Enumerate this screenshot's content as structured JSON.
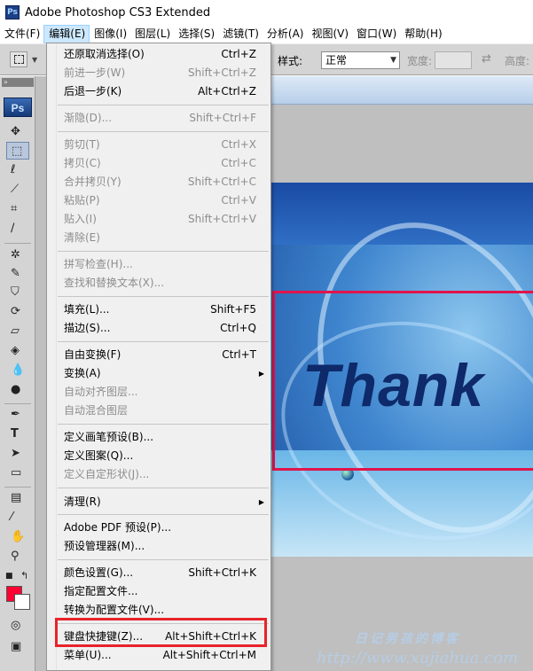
{
  "window": {
    "title": "Adobe Photoshop CS3 Extended",
    "app_icon": "Ps"
  },
  "menubar": [
    {
      "label": "文件(F)"
    },
    {
      "label": "编辑(E)"
    },
    {
      "label": "图像(I)"
    },
    {
      "label": "图层(L)"
    },
    {
      "label": "选择(S)"
    },
    {
      "label": "滤镜(T)"
    },
    {
      "label": "分析(A)"
    },
    {
      "label": "视图(V)"
    },
    {
      "label": "窗口(W)"
    },
    {
      "label": "帮助(H)"
    }
  ],
  "options_bar": {
    "style_label": "样式:",
    "style_value": "正常",
    "width_label": "宽度:",
    "height_label": "高度:"
  },
  "toolbox": {
    "logo": "Ps",
    "foreground_color": "#ff0033",
    "background_color": "#ffffff"
  },
  "edit_menu": {
    "items": [
      {
        "label": "还原取消选择(O)",
        "shortcut": "Ctrl+Z",
        "disabled": false
      },
      {
        "label": "前进一步(W)",
        "shortcut": "Shift+Ctrl+Z",
        "disabled": true
      },
      {
        "label": "后退一步(K)",
        "shortcut": "Alt+Ctrl+Z",
        "disabled": false
      },
      {
        "label": "渐隐(D)...",
        "shortcut": "Shift+Ctrl+F",
        "disabled": true
      },
      {
        "label": "剪切(T)",
        "shortcut": "Ctrl+X",
        "disabled": true
      },
      {
        "label": "拷贝(C)",
        "shortcut": "Ctrl+C",
        "disabled": true
      },
      {
        "label": "合并拷贝(Y)",
        "shortcut": "Shift+Ctrl+C",
        "disabled": true
      },
      {
        "label": "粘贴(P)",
        "shortcut": "Ctrl+V",
        "disabled": true
      },
      {
        "label": "贴入(I)",
        "shortcut": "Shift+Ctrl+V",
        "disabled": true
      },
      {
        "label": "清除(E)",
        "shortcut": "",
        "disabled": true
      },
      {
        "label": "拼写检查(H)...",
        "shortcut": "",
        "disabled": true
      },
      {
        "label": "查找和替换文本(X)...",
        "shortcut": "",
        "disabled": true
      },
      {
        "label": "填充(L)...",
        "shortcut": "Shift+F5",
        "disabled": false
      },
      {
        "label": "描边(S)...",
        "shortcut": "Ctrl+Q",
        "disabled": false
      },
      {
        "label": "自由变换(F)",
        "shortcut": "Ctrl+T",
        "disabled": false
      },
      {
        "label": "变换(A)",
        "shortcut": "",
        "disabled": false,
        "submenu": true
      },
      {
        "label": "自动对齐图层...",
        "shortcut": "",
        "disabled": true
      },
      {
        "label": "自动混合图层",
        "shortcut": "",
        "disabled": true
      },
      {
        "label": "定义画笔预设(B)...",
        "shortcut": "",
        "disabled": false
      },
      {
        "label": "定义图案(Q)...",
        "shortcut": "",
        "disabled": false
      },
      {
        "label": "定义自定形状(J)...",
        "shortcut": "",
        "disabled": true
      },
      {
        "label": "清理(R)",
        "shortcut": "",
        "disabled": false,
        "submenu": true
      },
      {
        "label": "Adobe PDF 预设(P)...",
        "shortcut": "",
        "disabled": false
      },
      {
        "label": "预设管理器(M)...",
        "shortcut": "",
        "disabled": false
      },
      {
        "label": "颜色设置(G)...",
        "shortcut": "Shift+Ctrl+K",
        "disabled": false
      },
      {
        "label": "指定配置文件...",
        "shortcut": "",
        "disabled": false
      },
      {
        "label": "转换为配置文件(V)...",
        "shortcut": "",
        "disabled": false
      },
      {
        "label": "键盘快捷键(Z)...",
        "shortcut": "Alt+Shift+Ctrl+K",
        "disabled": false,
        "highlighted": true
      },
      {
        "label": "菜单(U)...",
        "shortcut": "Alt+Shift+Ctrl+M",
        "disabled": false
      }
    ]
  },
  "canvas": {
    "image_text": "Thank",
    "selection_color": "#e0144b"
  },
  "watermark": {
    "line1": "日记男孩的博客",
    "line2": "http://www.xujiahua.com"
  }
}
